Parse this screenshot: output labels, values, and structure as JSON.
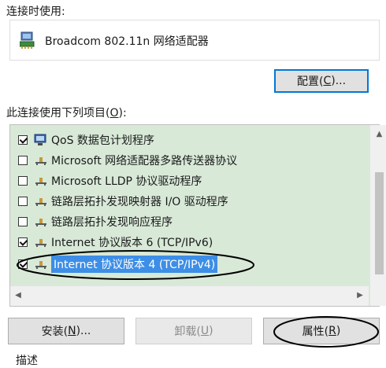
{
  "connect_using_label": "连接时使用:",
  "adapter": {
    "name": "Broadcom 802.11n 网络适配器",
    "icon": "network-adapter-icon"
  },
  "configure_button": {
    "label": "配置(",
    "hotkey": "C",
    "suffix": ")..."
  },
  "items_label": {
    "text": "此连接使用下列项目(",
    "hotkey": "O",
    "suffix": "):"
  },
  "items": [
    {
      "label": "QoS 数据包计划程序",
      "checked": true,
      "icon": "qos-scheduler-icon"
    },
    {
      "label": "Microsoft 网络适配器多路传送器协议",
      "checked": false,
      "icon": "protocol-icon"
    },
    {
      "label": "Microsoft LLDP 协议驱动程序",
      "checked": false,
      "icon": "protocol-icon"
    },
    {
      "label": "链路层拓扑发现映射器 I/O 驱动程序",
      "checked": false,
      "icon": "protocol-icon"
    },
    {
      "label": "链路层拓扑发现响应程序",
      "checked": false,
      "icon": "protocol-icon"
    },
    {
      "label": "Internet 协议版本 6 (TCP/IPv6)",
      "checked": true,
      "icon": "protocol-icon"
    },
    {
      "label": "Internet 协议版本 4 (TCP/IPv4)",
      "checked": true,
      "icon": "protocol-icon",
      "selected": true
    }
  ],
  "buttons": {
    "install": {
      "label": "安装(",
      "hotkey": "N",
      "suffix": ")..."
    },
    "uninstall": {
      "label": "卸载(",
      "hotkey": "U",
      "suffix": ")"
    },
    "properties": {
      "label": "属性(",
      "hotkey": "R",
      "suffix": ")"
    }
  },
  "description_label": "描述",
  "colors": {
    "list_bg": "#d8e9d8",
    "selection": "#3d8ee6",
    "annotation": "#000000"
  }
}
